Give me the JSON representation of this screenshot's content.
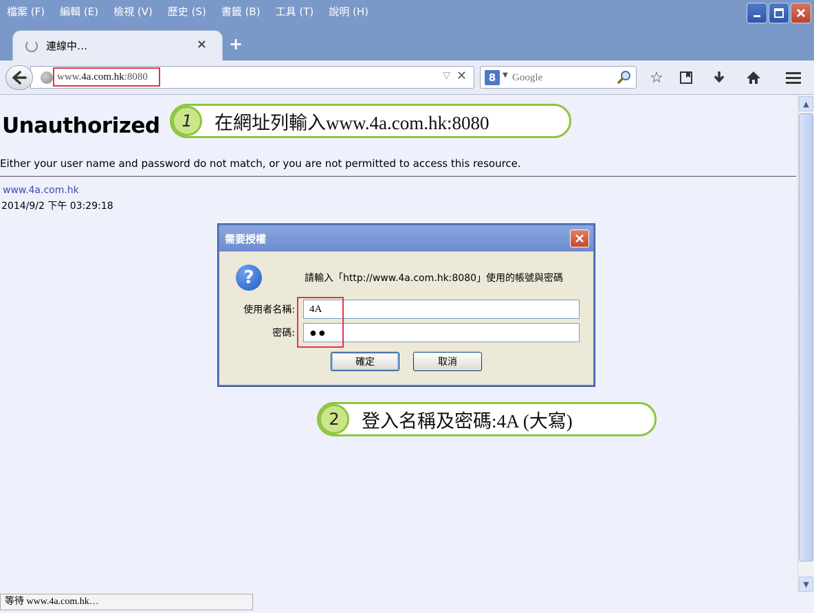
{
  "menu": {
    "items": [
      "檔案 (F)",
      "編輯 (E)",
      "檢視 (V)",
      "歷史 (S)",
      "書籤 (B)",
      "工具 (T)",
      "說明 (H)"
    ]
  },
  "tab": {
    "title": "連線中…",
    "close_glyph": "×",
    "new_tab_glyph": "+"
  },
  "urlbar": {
    "prefix": "www.",
    "host": "4a.com.hk",
    "port": ":8080"
  },
  "search": {
    "engine_glyph": "8",
    "placeholder": "Google"
  },
  "page": {
    "heading": "Unauthorized",
    "message": "Either your user name and password do not match, or you are not permitted to access this resource.",
    "footer_link": "www.4a.com.hk",
    "footer_time": "2014/9/2 下午 03:29:18"
  },
  "callouts": [
    {
      "number": "1",
      "text": "在網址列輸入www.4a.com.hk:8080"
    },
    {
      "number": "2",
      "text": "登入名稱及密碼:4A (大寫)"
    }
  ],
  "dialog": {
    "title": "需要授權",
    "prompt": "請輸入「http://www.4a.com.hk:8080」使用的帳號與密碼",
    "username_label": "使用者名稱:",
    "username_value": "4A",
    "password_label": "密碼:",
    "password_value": "●●",
    "ok_label": "確定",
    "cancel_label": "取消"
  },
  "status": {
    "text": "等待 www.4a.com.hk…"
  },
  "colors": {
    "titlebar": "#7a98c8",
    "callout_border": "#8cc63f",
    "highlight_red": "#e0354d",
    "link": "#3c4ab0"
  }
}
